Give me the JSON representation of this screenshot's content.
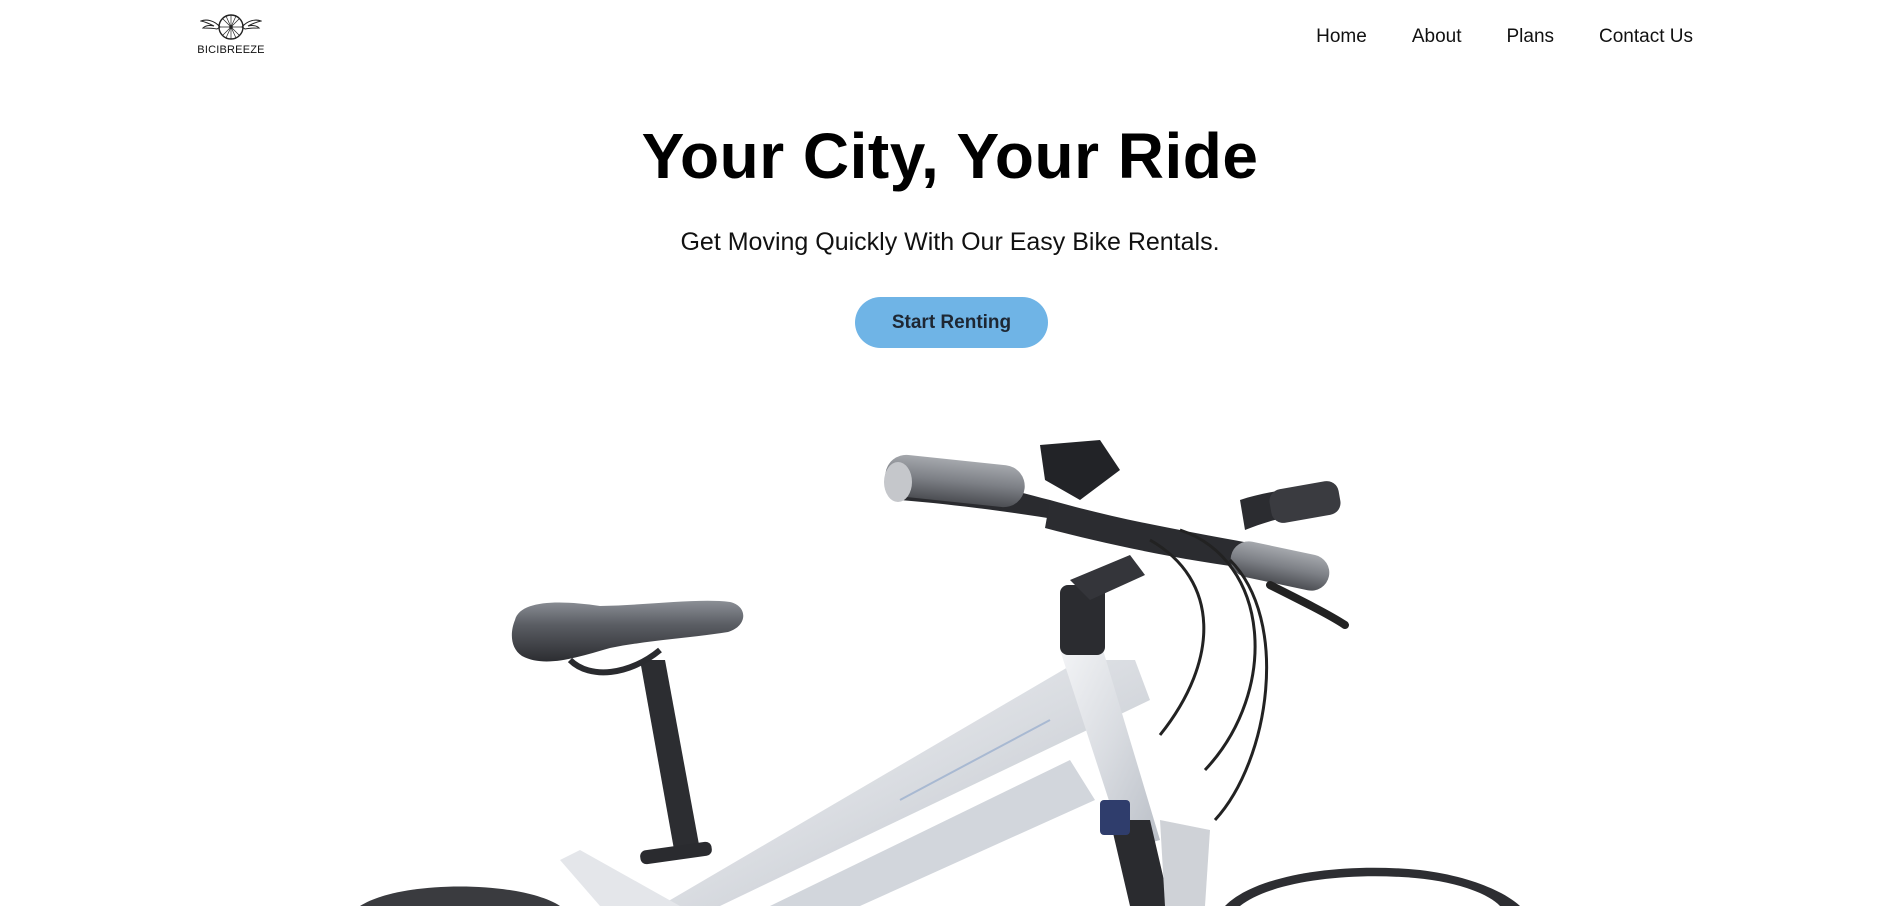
{
  "brand": {
    "name": "BICIBREEZE",
    "logo_icon": "winged-wheel-icon"
  },
  "nav": {
    "items": [
      {
        "label": "Home"
      },
      {
        "label": "About"
      },
      {
        "label": "Plans"
      },
      {
        "label": "Contact Us"
      }
    ]
  },
  "hero": {
    "title": "Your City, Your Ride",
    "subtitle": "Get Moving Quickly With Our Easy Bike Rentals.",
    "cta_label": "Start Renting",
    "cta_color": "#6fb4e6",
    "image": "white-bicycle-photo"
  }
}
